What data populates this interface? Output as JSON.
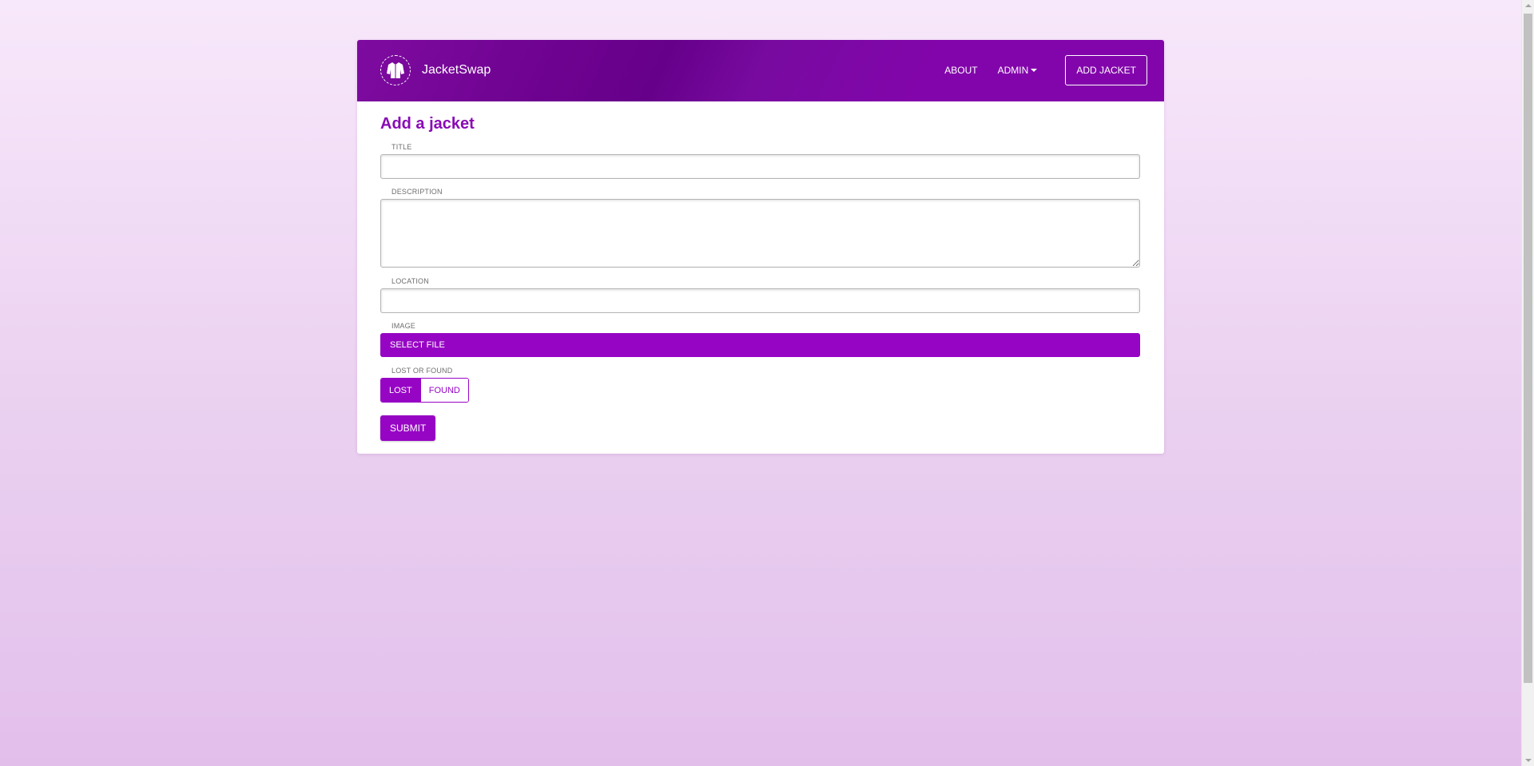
{
  "nav": {
    "brand_name": "JacketSwap",
    "logo_icon": "jacket-icon",
    "about_label": "ABOUT",
    "admin_label": "ADMIN",
    "cta_label": "ADD JACKET"
  },
  "form": {
    "title": "Add a jacket",
    "title_label": "TITLE",
    "title_value": "",
    "description_label": "DESCRIPTION",
    "description_value": "",
    "location_label": "LOCATION",
    "location_value": "",
    "image_label": "IMAGE",
    "select_file_label": "SELECT FILE",
    "lost_or_found_label": "LOST OR FOUND",
    "options": [
      "LOST",
      "FOUND"
    ],
    "selected_option": "LOST",
    "submit_label": "SUBMIT"
  },
  "colors": {
    "accent": "#9705c4",
    "title": "#8a0ab5",
    "navbar": "#8205ab"
  }
}
